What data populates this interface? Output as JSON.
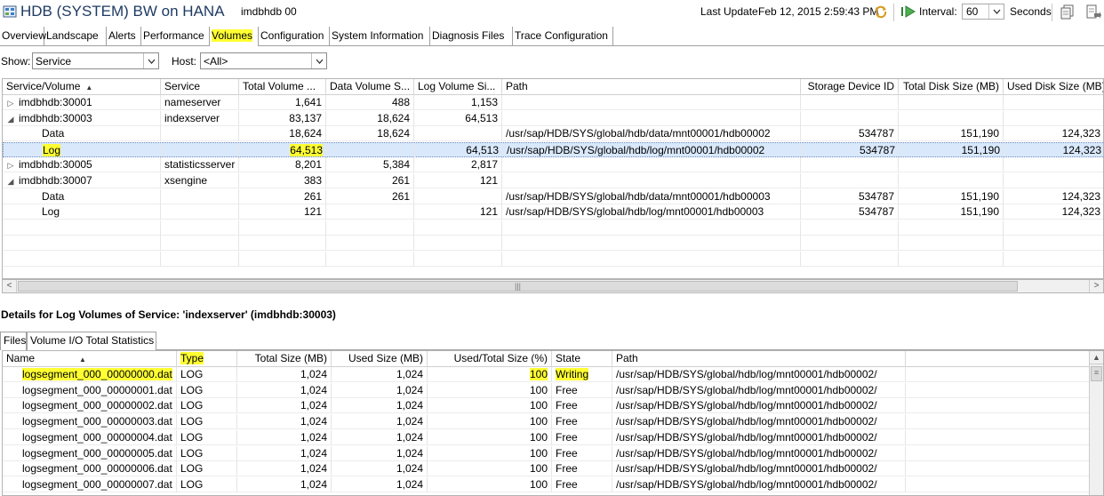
{
  "window": {
    "title": "HDB (SYSTEM) BW on HANA",
    "subtitle": "imdbhdb 00",
    "last_update_label": "Last Update:",
    "last_update_value": "Feb 12, 2015 2:59:43 PM",
    "interval_label": "Interval:",
    "interval_value": "60",
    "seconds_label": "Seconds"
  },
  "icons": {
    "app": "database-icon",
    "refresh": "refresh-icon",
    "play": "play-icon",
    "toolbar1": "copy-icon",
    "toolbar2": "export-icon"
  },
  "tabs": [
    {
      "label": "Overview"
    },
    {
      "label": "Landscape"
    },
    {
      "label": "Alerts"
    },
    {
      "label": "Performance"
    },
    {
      "label": "Volumes",
      "active": true
    },
    {
      "label": "Configuration"
    },
    {
      "label": "System Information"
    },
    {
      "label": "Diagnosis Files"
    },
    {
      "label": "Trace Configuration"
    }
  ],
  "filters": {
    "show_label": "Show:",
    "show_value": "Service",
    "host_label": "Host:",
    "host_value": "<All>"
  },
  "volumes_table": {
    "columns": [
      "Service/Volume",
      "Service",
      "Total Volume ...",
      "Data Volume S...",
      "Log Volume Si...",
      "Path",
      "Storage Device ID",
      "Total Disk Size (MB)",
      "Used Disk Size (MB)"
    ],
    "rows": [
      {
        "name": "imdbhdb:30001",
        "tree": "collapsed",
        "service": "nameserver",
        "total": "1,641",
        "data": "488",
        "log": "1,153",
        "path": "",
        "device": "",
        "disk_total": "",
        "disk_used": ""
      },
      {
        "name": "imdbhdb:30003",
        "tree": "expanded",
        "service": "indexserver",
        "total": "83,137",
        "data": "18,624",
        "log": "64,513",
        "path": "",
        "device": "",
        "disk_total": "",
        "disk_used": ""
      },
      {
        "name": "Data",
        "tree": "child",
        "service": "",
        "total": "18,624",
        "data": "18,624",
        "log": "",
        "path": "/usr/sap/HDB/SYS/global/hdb/data/mnt00001/hdb00002",
        "device": "534787",
        "disk_total": "151,190",
        "disk_used": "124,323"
      },
      {
        "name": "Log",
        "tree": "child",
        "selected": true,
        "service": "",
        "total": "64,513",
        "data": "",
        "log": "64,513",
        "path": "/usr/sap/HDB/SYS/global/hdb/log/mnt00001/hdb00002",
        "device": "534787",
        "disk_total": "151,190",
        "disk_used": "124,323"
      },
      {
        "name": "imdbhdb:30005",
        "tree": "collapsed",
        "service": "statisticsserver",
        "total": "8,201",
        "data": "5,384",
        "log": "2,817",
        "path": "",
        "device": "",
        "disk_total": "",
        "disk_used": ""
      },
      {
        "name": "imdbhdb:30007",
        "tree": "expanded",
        "service": "xsengine",
        "total": "383",
        "data": "261",
        "log": "121",
        "path": "",
        "device": "",
        "disk_total": "",
        "disk_used": ""
      },
      {
        "name": "Data",
        "tree": "child",
        "service": "",
        "total": "261",
        "data": "261",
        "log": "",
        "path": "/usr/sap/HDB/SYS/global/hdb/data/mnt00001/hdb00003",
        "device": "534787",
        "disk_total": "151,190",
        "disk_used": "124,323"
      },
      {
        "name": "Log",
        "tree": "child",
        "service": "",
        "total": "121",
        "data": "",
        "log": "121",
        "path": "/usr/sap/HDB/SYS/global/hdb/log/mnt00001/hdb00003",
        "device": "534787",
        "disk_total": "151,190",
        "disk_used": "124,323"
      }
    ]
  },
  "details": {
    "title": "Details for Log Volumes of Service: 'indexserver' (imdbhdb:30003)",
    "subtabs": [
      "Files",
      "Volume I/O Total Statistics"
    ]
  },
  "files_table": {
    "columns": [
      "Name",
      "Type",
      "Total Size (MB)",
      "Used Size (MB)",
      "Used/Total Size (%)",
      "State",
      "Path"
    ],
    "rows": [
      {
        "name": "logsegment_000_00000000.dat",
        "type": "LOG",
        "total": "1,024",
        "used": "1,024",
        "pct": "100",
        "state": "Writing",
        "path": "/usr/sap/HDB/SYS/global/hdb/log/mnt00001/hdb00002/"
      },
      {
        "name": "logsegment_000_00000001.dat",
        "type": "LOG",
        "total": "1,024",
        "used": "1,024",
        "pct": "100",
        "state": "Free",
        "path": "/usr/sap/HDB/SYS/global/hdb/log/mnt00001/hdb00002/"
      },
      {
        "name": "logsegment_000_00000002.dat",
        "type": "LOG",
        "total": "1,024",
        "used": "1,024",
        "pct": "100",
        "state": "Free",
        "path": "/usr/sap/HDB/SYS/global/hdb/log/mnt00001/hdb00002/"
      },
      {
        "name": "logsegment_000_00000003.dat",
        "type": "LOG",
        "total": "1,024",
        "used": "1,024",
        "pct": "100",
        "state": "Free",
        "path": "/usr/sap/HDB/SYS/global/hdb/log/mnt00001/hdb00002/"
      },
      {
        "name": "logsegment_000_00000004.dat",
        "type": "LOG",
        "total": "1,024",
        "used": "1,024",
        "pct": "100",
        "state": "Free",
        "path": "/usr/sap/HDB/SYS/global/hdb/log/mnt00001/hdb00002/"
      },
      {
        "name": "logsegment_000_00000005.dat",
        "type": "LOG",
        "total": "1,024",
        "used": "1,024",
        "pct": "100",
        "state": "Free",
        "path": "/usr/sap/HDB/SYS/global/hdb/log/mnt00001/hdb00002/"
      },
      {
        "name": "logsegment_000_00000006.dat",
        "type": "LOG",
        "total": "1,024",
        "used": "1,024",
        "pct": "100",
        "state": "Free",
        "path": "/usr/sap/HDB/SYS/global/hdb/log/mnt00001/hdb00002/"
      },
      {
        "name": "logsegment_000_00000007.dat",
        "type": "LOG",
        "total": "1,024",
        "used": "1,024",
        "pct": "100",
        "state": "Free",
        "path": "/usr/sap/HDB/SYS/global/hdb/log/mnt00001/hdb00002/"
      }
    ]
  },
  "colors": {
    "highlight": "#ffff33",
    "selection": "#d9e8fb",
    "title": "#1f3b63"
  }
}
